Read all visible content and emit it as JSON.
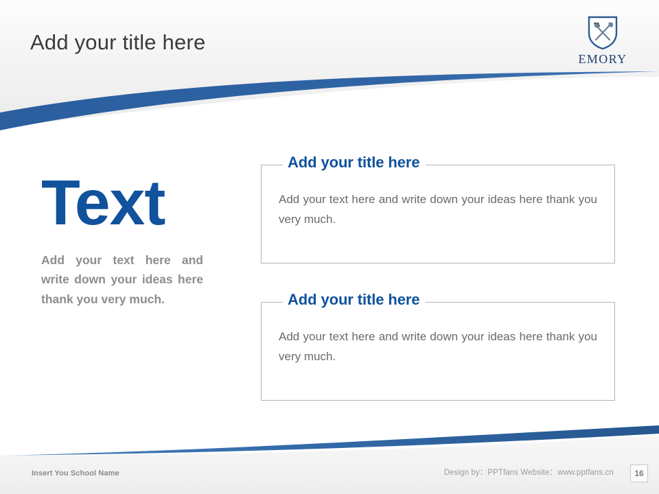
{
  "slide": {
    "title": "Add your title here",
    "page_number": "16",
    "accent_blue": "#10529c",
    "swoosh_blue": "#2b5f9e",
    "logo_navy": "#1f3f70",
    "body_gray": "#6a6a6a",
    "left_body_gray": "#8d8d8d"
  },
  "logo": {
    "wordmark": "EMORY",
    "shield_icon": "shield-with-crossed-torch-and-trumpet-icon"
  },
  "left_column": {
    "headline": "Text",
    "body": "Add your text here and write down your ideas here thank you very much."
  },
  "boxes": [
    {
      "title": "Add your title here",
      "body": "Add your text here and write down your ideas here thank you very much."
    },
    {
      "title": "Add your title here",
      "body": "Add your text here and write down your ideas here thank you very much."
    }
  ],
  "footer": {
    "school_name": "Insert You School Name",
    "credit": "Design by：PPTfans  Website：www.pptfans.cn"
  }
}
